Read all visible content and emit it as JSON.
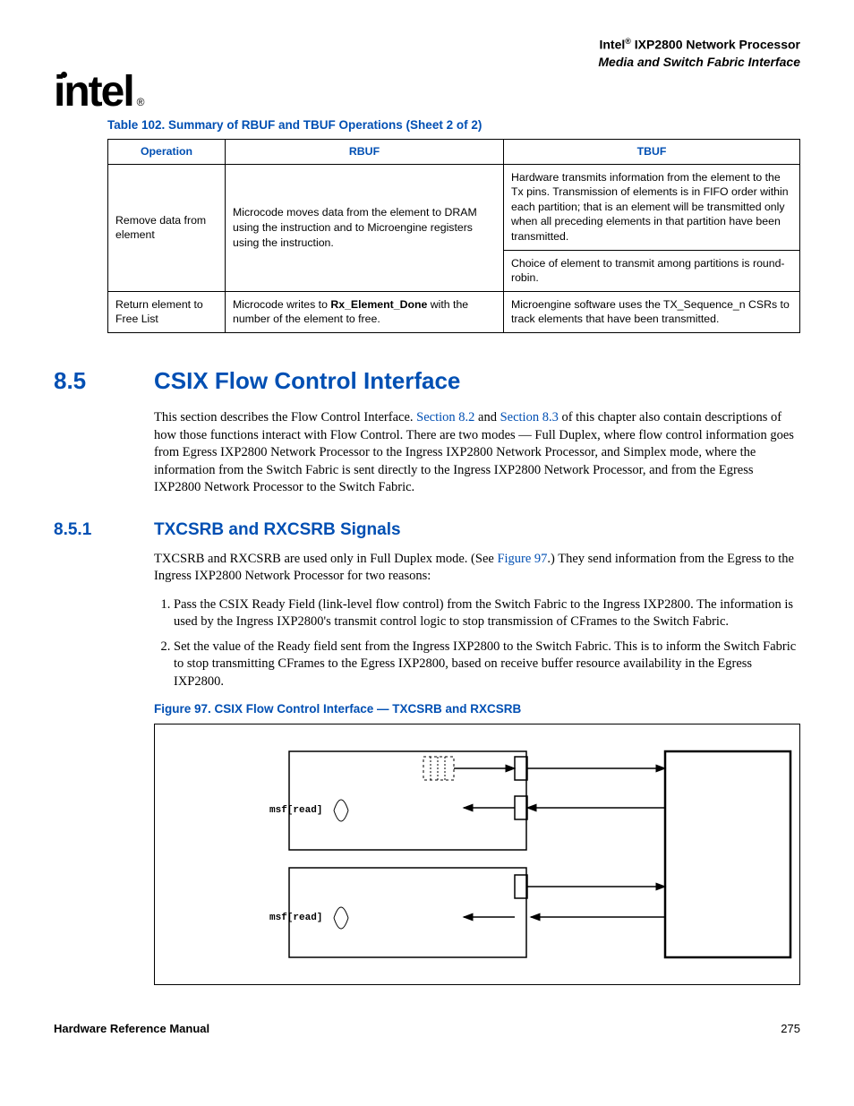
{
  "header": {
    "brand": "Intel",
    "reg": "®",
    "product": " IXP2800 Network Processor",
    "subtitle": "Media and Switch Fabric Interface"
  },
  "logo": {
    "text": "intel",
    "reg": "®"
  },
  "table_caption": "Table 102. Summary of RBUF and TBUF Operations (Sheet 2 of 2)",
  "table": {
    "headers": [
      "Operation",
      "RBUF",
      "TBUF"
    ],
    "rows": [
      {
        "op": "Remove data from element",
        "rbuf": "Microcode moves data from the element to DRAM using the                              instruction and to Microengine registers using the instruction.",
        "tbuf_a": "Hardware transmits information from the element to the Tx pins. Transmission of elements is in FIFO order within each partition; that is an element will be transmitted only when all preceding elements in that partition have been transmitted.",
        "tbuf_b": "Choice of element to transmit among partitions is round-robin."
      },
      {
        "op": "Return element to Free List",
        "rbuf_pre": "Microcode writes to ",
        "rbuf_bold": "Rx_Element_Done",
        "rbuf_post": " with the number of the element to free.",
        "tbuf": "Microengine software uses the TX_Sequence_n CSRs to track elements that have been transmitted."
      }
    ]
  },
  "sec85": {
    "num": "8.5",
    "title": "CSIX Flow Control Interface",
    "p_pre": "This section describes the Flow Control Interface. ",
    "link1": "Section 8.2",
    "mid": " and ",
    "link2": "Section 8.3",
    "p_post": " of this chapter also contain descriptions of how those functions interact with Flow Control. There are two modes — Full Duplex, where flow control information goes from Egress IXP2800 Network Processor to the Ingress IXP2800 Network Processor, and Simplex mode, where the information from the Switch Fabric is sent directly to the Ingress IXP2800 Network Processor, and from the Egress IXP2800 Network Processor to the Switch Fabric."
  },
  "sec851": {
    "num": "8.5.1",
    "title": "TXCSRB and RXCSRB Signals",
    "p_pre": "TXCSRB and RXCSRB are used only in Full Duplex mode. (See ",
    "link": "Figure 97",
    "p_post": ".) They send information from the Egress to the Ingress IXP2800 Network Processor for two reasons:",
    "li1": "Pass the CSIX Ready Field (link-level flow control) from the Switch Fabric to the Ingress IXP2800. The information is used by the Ingress IXP2800's transmit control logic to stop transmission of CFrames to the Switch Fabric.",
    "li2": "Set the value of the Ready field sent from the Ingress IXP2800 to the Switch Fabric. This is to inform the Switch Fabric to stop transmitting CFrames to the Egress IXP2800, based on receive buffer resource availability in the Egress IXP2800."
  },
  "fig_caption": "Figure 97. CSIX Flow Control Interface — TXCSRB and RXCSRB",
  "fig_labels": {
    "msf1": "msf[read]",
    "msf2": "msf[read]"
  },
  "footer": {
    "left": "Hardware Reference Manual",
    "right": "275"
  }
}
